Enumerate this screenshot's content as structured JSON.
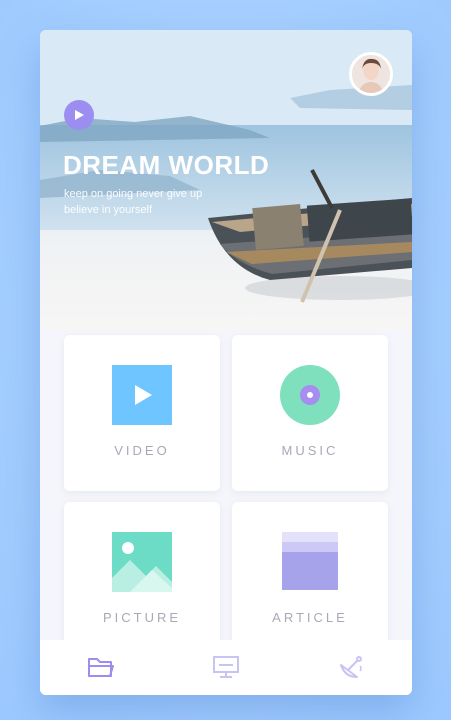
{
  "hero": {
    "title": "DREAM WORLD",
    "subtitle_line1": "keep on going never give up",
    "subtitle_line2": "believe in yourself"
  },
  "cards": [
    {
      "label": "VIDEO",
      "icon": "video-icon"
    },
    {
      "label": "MUSIC",
      "icon": "music-disc-icon"
    },
    {
      "label": "PICTURE",
      "icon": "picture-icon"
    },
    {
      "label": "ARTICLE",
      "icon": "article-icon"
    }
  ],
  "tabbar": {
    "items": [
      "folder-icon",
      "monitor-icon",
      "satellite-dish-icon"
    ],
    "active": "folder-icon"
  },
  "colors": {
    "accent": "#9b8ef0",
    "video": "#6fc5ff",
    "music": "#7ee0bd",
    "picture": "#6ddcc6",
    "article": "#a7a3ea",
    "label": "#a7aab6",
    "background": "#a8d1ff"
  }
}
